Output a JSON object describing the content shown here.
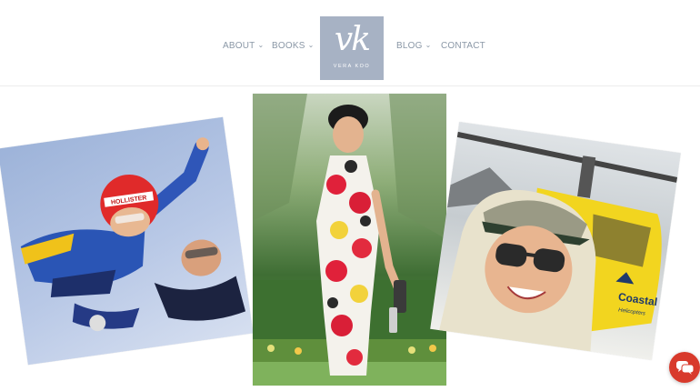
{
  "nav": {
    "about": "ABOUT",
    "books": "BOOKS",
    "blog": "BLOG",
    "contact": "CONTACT"
  },
  "logo": {
    "monogram": "vk",
    "wordmark": "VERA KOO"
  },
  "photos": {
    "skydiving": {
      "helmet_text": "HOLLISTER"
    },
    "helicopter": {
      "brand_text": "Coastal",
      "sub_text": "Helicopters"
    }
  },
  "chat": {
    "icon": "chat-bubbles-icon"
  }
}
